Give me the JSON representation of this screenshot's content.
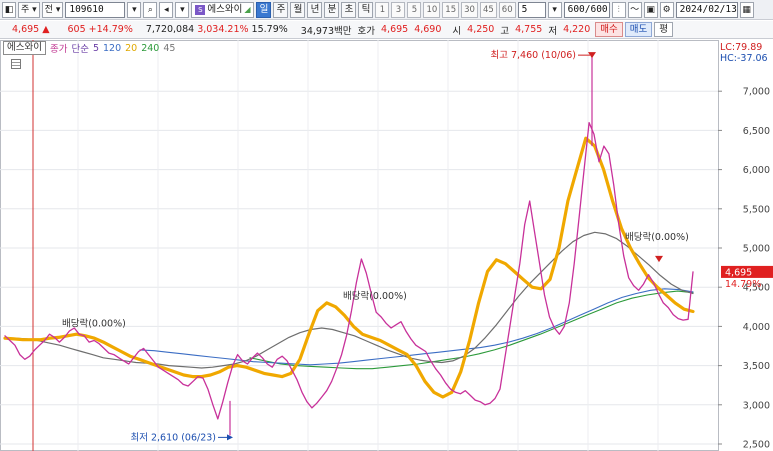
{
  "toolbar": {
    "type_select": "주",
    "market_select": "전",
    "code": "109610",
    "stock_name": "에스와이",
    "periods": [
      "일",
      "주",
      "월",
      "년",
      "분",
      "초",
      "틱"
    ],
    "active_period": "일",
    "intervals": [
      "1",
      "3",
      "5",
      "10",
      "15",
      "30",
      "45",
      "60"
    ],
    "interval_value": "5",
    "count": "600/600",
    "date": "2024/02/13"
  },
  "quote": {
    "price": "4,695",
    "change": "605",
    "change_pct": "+14.79%",
    "volume": "7,720,084",
    "volume_pct": "3,034.21%",
    "turnover_pct": "15.79%",
    "amount": "34,973백만",
    "ask_label": "호가",
    "ask": "4,695",
    "bid": "4,690",
    "open_label": "시",
    "open": "4,250",
    "high_label": "고",
    "high": "4,755",
    "low_label": "저",
    "low": "4,220",
    "buy_label": "매수",
    "sell_label": "매도",
    "eval_label": "평"
  },
  "legend": {
    "name": "에스와이",
    "price_label": "종가",
    "ma_type": "단순",
    "ma5": "5",
    "ma120": "120",
    "ma20": "20",
    "ma240": "240",
    "ma45": "45"
  },
  "axis_info": {
    "lc": "LC:79.89",
    "hc": "HC:-37.06"
  },
  "chart_data": {
    "type": "line",
    "title": "",
    "ylim": [
      2500,
      7500
    ],
    "y_ticks": [
      2500,
      3000,
      3500,
      4000,
      4500,
      5000,
      5500,
      6000,
      6500,
      7000
    ],
    "y_tick_labels": [
      "2,500",
      "3,000",
      "3,500",
      "4,000",
      "4,500",
      "5,000",
      "5,500",
      "6,000",
      "6,500",
      "7,000"
    ],
    "current_price": "4,695",
    "current_pct": "14.79%",
    "series": [
      {
        "values": [
          3880,
          3820,
          3760,
          3640,
          3580,
          3620,
          3700,
          3760,
          3820,
          3900,
          3860,
          3800,
          3860,
          3940,
          3980,
          3900,
          3880,
          3800,
          3820,
          3780,
          3720,
          3660,
          3640,
          3600,
          3560,
          3520,
          3600,
          3680,
          3720,
          3640,
          3560,
          3480,
          3440,
          3400,
          3360,
          3320,
          3260,
          3240,
          3300,
          3360,
          3340,
          3200,
          3000,
          2820,
          3040,
          3280,
          3500,
          3640,
          3560,
          3520,
          3600,
          3660,
          3600,
          3520,
          3480,
          3580,
          3620,
          3560,
          3440,
          3320,
          3160,
          3040,
          2960,
          3020,
          3100,
          3180,
          3300,
          3460,
          3640,
          3880,
          4200,
          4560,
          4860,
          4680,
          4420,
          4180,
          4120,
          4040,
          3980,
          4020,
          4060,
          3940,
          3840,
          3760,
          3720,
          3680,
          3560,
          3460,
          3380,
          3280,
          3200,
          3160,
          3140,
          3180,
          3120,
          3060,
          3040,
          3000,
          3020,
          3080,
          3200,
          3600,
          4000,
          4400,
          4800,
          5300,
          5600,
          5200,
          4800,
          4400,
          4120,
          3980,
          3900,
          4000,
          4300,
          4800,
          5400,
          6000,
          6600,
          6450,
          6100,
          6300,
          6200,
          5800,
          5300,
          4900,
          4620,
          4520,
          4460,
          4540,
          4660,
          4560,
          4420,
          4300,
          4240,
          4150,
          4100,
          4080,
          4090,
          4695
        ]
      },
      {
        "values": [
          3850,
          3840,
          3830,
          3830,
          3830,
          3850,
          3860,
          3880,
          3900,
          3880,
          3850,
          3800,
          3740,
          3680,
          3620,
          3580,
          3540,
          3500,
          3460,
          3420,
          3380,
          3360,
          3360,
          3380,
          3420,
          3480,
          3500,
          3480,
          3440,
          3400,
          3380,
          3360,
          3400,
          3580,
          3900,
          4200,
          4300,
          4250,
          4140,
          4000,
          3900,
          3860,
          3820,
          3760,
          3700,
          3640,
          3500,
          3300,
          3160,
          3100,
          3160,
          3420,
          3820,
          4300,
          4700,
          4850,
          4800,
          4700,
          4600,
          4500,
          4480,
          4600,
          5000,
          5600,
          6000,
          6400,
          6300,
          6000,
          5600,
          5250,
          5000,
          4800,
          4620,
          4500,
          4400,
          4300,
          4220,
          4190
        ]
      },
      {
        "values": [
          3850,
          3850,
          3840,
          3820,
          3790,
          3760,
          3720,
          3680,
          3640,
          3600,
          3580,
          3560,
          3540,
          3530,
          3520,
          3500,
          3490,
          3480,
          3470,
          3480,
          3500,
          3520,
          3560,
          3620,
          3700,
          3780,
          3860,
          3920,
          3960,
          3980,
          3960,
          3920,
          3880,
          3820,
          3760,
          3700,
          3650,
          3600,
          3570,
          3550,
          3540,
          3560,
          3620,
          3720,
          3860,
          4020,
          4200,
          4380,
          4540,
          4680,
          4820,
          4960,
          5080,
          5160,
          5200,
          5180,
          5120,
          5020,
          4900,
          4780,
          4650,
          4540,
          4460,
          4420
        ]
      },
      {
        "values": [
          3700,
          3690,
          3670,
          3650,
          3630,
          3610,
          3590,
          3570,
          3550,
          3540,
          3530,
          3520,
          3510,
          3520,
          3530,
          3550,
          3570,
          3590,
          3610,
          3630,
          3650,
          3670,
          3690,
          3710,
          3730,
          3760,
          3800,
          3850,
          3910,
          3980,
          4060,
          4140,
          4220,
          4300,
          4370,
          4420,
          4460,
          4480,
          4470,
          4440
        ]
      },
      {
        "values": [
          3600,
          3560,
          3520,
          3500,
          3490,
          3480,
          3470,
          3460,
          3460,
          3480,
          3500,
          3520,
          3550,
          3580,
          3610,
          3650,
          3700,
          3760,
          3830,
          3900,
          3980,
          4060,
          4140,
          4220,
          4300,
          4360,
          4400,
          4430,
          4450,
          4430
        ]
      }
    ],
    "annotations": [
      {
        "label": "최고 7,460 (10/06)",
        "value": 7460
      },
      {
        "label": "최저 2,610 (06/23)",
        "value": 2610
      },
      {
        "label": "배당락(0.00%)"
      },
      {
        "label": "배당락(0.00%)"
      },
      {
        "label": "배당락(0.00%)"
      }
    ],
    "colors": {
      "price": "#c8319a",
      "ma5": "#6b3fa6",
      "ma20": "#f0a800",
      "ma45": "#6e6e6e",
      "ma120": "#3b6dc4",
      "ma240": "#2c9a3a",
      "current_price_bg": "#e02020"
    }
  }
}
